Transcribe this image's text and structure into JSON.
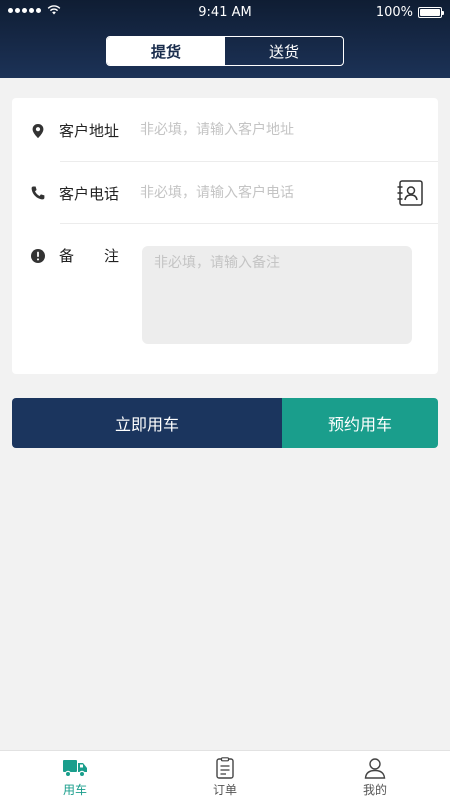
{
  "status_bar": {
    "time": "9:41 AM",
    "battery": "100%",
    "battery_level": 1.0
  },
  "header": {
    "tabs": [
      {
        "label": "提货",
        "active": true
      },
      {
        "label": "送货",
        "active": false
      }
    ]
  },
  "form": {
    "address": {
      "label": "客户地址",
      "placeholder": "非必填，请输入客户地址",
      "value": ""
    },
    "phone": {
      "label": "客户电话",
      "placeholder": "非必填，请输入客户电话",
      "value": ""
    },
    "note": {
      "label": "备　　注",
      "placeholder": "非必填，请输入备注",
      "value": ""
    }
  },
  "actions": {
    "now_label": "立即用车",
    "book_label": "预约用车"
  },
  "tabbar": {
    "items": [
      {
        "label": "用车",
        "icon": "truck-icon",
        "active": true
      },
      {
        "label": "订单",
        "icon": "order-list-icon",
        "active": false
      },
      {
        "label": "我的",
        "icon": "user-icon",
        "active": false
      }
    ]
  },
  "colors": {
    "header_dark": "#0f1d33",
    "primary_navy": "#1b355e",
    "accent_teal": "#1a9e8c",
    "background": "#f2f2f2"
  }
}
